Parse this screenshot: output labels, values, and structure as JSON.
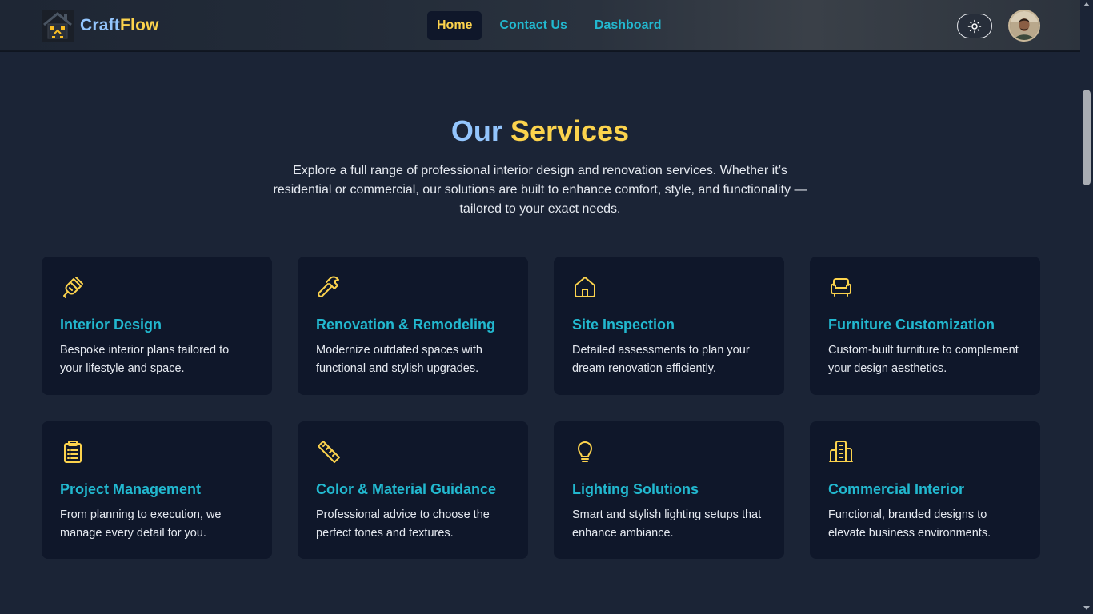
{
  "navbar": {
    "brand_part1": "Craft",
    "brand_part2": "Flow",
    "links": [
      {
        "label": "Home",
        "active": true
      },
      {
        "label": "Contact Us",
        "active": false
      },
      {
        "label": "Dashboard",
        "active": false
      }
    ],
    "theme_toggle_icon": "sun-icon",
    "avatar_icon": "user-avatar"
  },
  "services": {
    "title_part1": "Our",
    "title_part2": "Services",
    "description": "Explore a full range of professional interior design and renovation services. Whether it’s residential or commercial, our solutions are built to enhance comfort, style, and functionality — tailored to your exact needs.",
    "cards": [
      {
        "icon": "paintbrush-icon",
        "title": "Interior Design",
        "description": "Bespoke interior plans tailored to your lifestyle and space."
      },
      {
        "icon": "hammer-icon",
        "title": "Renovation & Remodeling",
        "description": "Modernize outdated spaces with functional and stylish upgrades."
      },
      {
        "icon": "home-icon",
        "title": "Site Inspection",
        "description": "Detailed assessments to plan your dream renovation efficiently."
      },
      {
        "icon": "sofa-icon",
        "title": "Furniture Customization",
        "description": "Custom-built furniture to complement your design aesthetics."
      },
      {
        "icon": "clipboard-icon",
        "title": "Project Management",
        "description": "From planning to execution, we manage every detail for you."
      },
      {
        "icon": "ruler-icon",
        "title": "Color & Material Guidance",
        "description": "Professional advice to choose the perfect tones and textures."
      },
      {
        "icon": "lightbulb-icon",
        "title": "Lighting Solutions",
        "description": "Smart and stylish lighting setups that enhance ambiance."
      },
      {
        "icon": "building-icon",
        "title": "Commercial Interior",
        "description": "Functional, branded designs to elevate business environments."
      }
    ]
  },
  "colors": {
    "background": "#1b2436",
    "card_background": "#0f172a",
    "accent_yellow": "#fcd34d",
    "accent_blue": "#93c5fd",
    "accent_cyan": "#22b8cf"
  }
}
